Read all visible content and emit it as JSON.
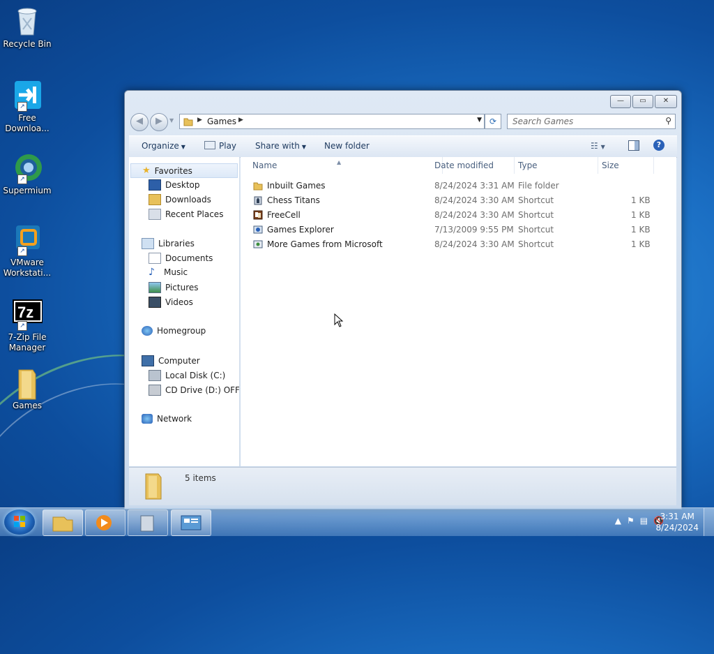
{
  "desktop": {
    "icons": [
      {
        "label_l1": "Recycle Bin",
        "label_l2": ""
      },
      {
        "label_l1": "Free",
        "label_l2": "Downloa..."
      },
      {
        "label_l1": "Supermium",
        "label_l2": ""
      },
      {
        "label_l1": "VMware",
        "label_l2": "Workstati..."
      },
      {
        "label_l1": "7-Zip File",
        "label_l2": "Manager"
      },
      {
        "label_l1": "Games",
        "label_l2": ""
      }
    ]
  },
  "window": {
    "controls": {
      "minimize": "—",
      "maximize": "▭",
      "close": "✕"
    },
    "address": {
      "crumb": "Games"
    },
    "search": {
      "placeholder": "Search Games"
    },
    "toolbar": {
      "organize": "Organize",
      "play": "Play",
      "share_with": "Share with",
      "new_folder": "New folder"
    },
    "nav": {
      "favorites": "Favorites",
      "desktop": "Desktop",
      "downloads": "Downloads",
      "recent_places": "Recent Places",
      "libraries": "Libraries",
      "documents": "Documents",
      "music": "Music",
      "pictures": "Pictures",
      "videos": "Videos",
      "homegroup": "Homegroup",
      "computer": "Computer",
      "local_disk": "Local Disk (C:)",
      "cd_drive": "CD Drive (D:) OFFICE",
      "network": "Network"
    },
    "columns": {
      "name": "Name",
      "date_modified": "Date modified",
      "type": "Type",
      "size": "Size"
    },
    "files": [
      {
        "name": "Inbuilt Games",
        "date": "8/24/2024 3:31 AM",
        "type": "File folder",
        "size": ""
      },
      {
        "name": "Chess Titans",
        "date": "8/24/2024 3:30 AM",
        "type": "Shortcut",
        "size": "1 KB"
      },
      {
        "name": "FreeCell",
        "date": "8/24/2024 3:30 AM",
        "type": "Shortcut",
        "size": "1 KB"
      },
      {
        "name": "Games Explorer",
        "date": "7/13/2009 9:55 PM",
        "type": "Shortcut",
        "size": "1 KB"
      },
      {
        "name": "More Games from Microsoft",
        "date": "8/24/2024 3:30 AM",
        "type": "Shortcut",
        "size": "1 KB"
      }
    ],
    "details": {
      "count": "5 items"
    }
  },
  "taskbar": {
    "clock_time": "3:31 AM",
    "clock_date": "8/24/2024"
  }
}
